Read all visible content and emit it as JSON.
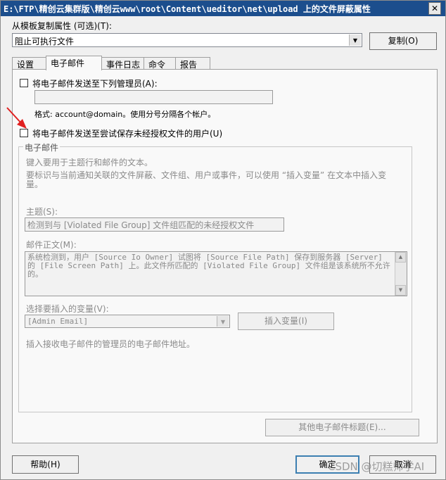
{
  "window": {
    "title": "E:\\FTP\\精创云集群版\\精创云www\\root\\Content\\ueditor\\net\\upload 上的文件屏蔽属性",
    "close_glyph": "✕"
  },
  "template": {
    "label": "从模板复制属性 (可选)(T):",
    "selected": "阻止可执行文件",
    "copy_button": "复制(O)"
  },
  "tabs": [
    {
      "label": "设置"
    },
    {
      "label": "电子邮件"
    },
    {
      "label": "事件日志"
    },
    {
      "label": "命令"
    },
    {
      "label": "报告"
    }
  ],
  "email_tab": {
    "send_admin_label": "将电子邮件发送至下列管理员(A):",
    "admin_email_value": "",
    "format_hint": "格式: account@domain。使用分号分隔各个帐户。",
    "send_user_label": "将电子邮件发送至尝试保存未经授权文件的用户(U)",
    "group_title": "电子邮件",
    "intro1": "键入要用于主题行和邮件的文本。",
    "intro2": "要标识与当前通知关联的文件屏蔽、文件组、用户或事件，可以使用 “插入变量” 在文本中插入变量。",
    "subject_label": "主题(S):",
    "subject_value": "检测到与 [Violated File Group] 文件组匹配的未经授权文件",
    "body_label": "邮件正文(M):",
    "body_value": "系统检测到，用户 [Source Io Owner] 试图将 [Source File Path] 保存到服务器 [Server] 的 [File Screen Path] 上。此文件所匹配的 [Violated File Group] 文件组是该系统所不允许的。",
    "variable_label": "选择要插入的变量(V):",
    "variable_selected": "[Admin Email]",
    "insert_button": "插入变量(I)",
    "variable_desc": "插入接收电子邮件的管理员的电子邮件地址。",
    "other_headers_button": "其他电子邮件标题(E)..."
  },
  "footer": {
    "help_button": "帮助(H)",
    "ok_button": "确定",
    "cancel_button": "取消"
  },
  "watermark": "CSDN @切糕师学AI",
  "colors": {
    "titlebar": "#1c4e8d",
    "annotation_arrow": "#e02020"
  }
}
